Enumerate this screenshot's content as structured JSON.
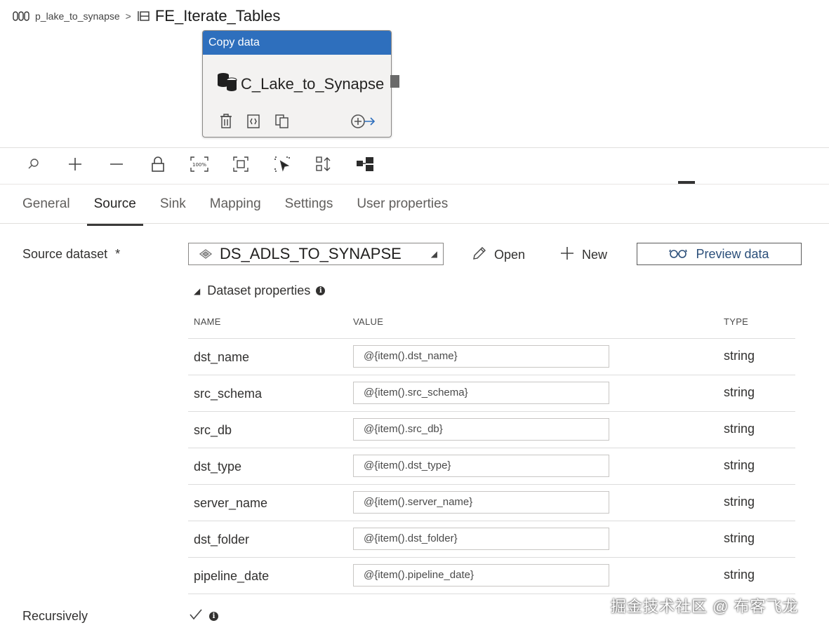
{
  "breadcrumb": {
    "pipeline": "p_lake_to_synapse",
    "separator": ">",
    "activity": "FE_Iterate_Tables"
  },
  "card": {
    "header": "Copy data",
    "name": "C_Lake_to_Synapse",
    "header_color": "#2e6fbd"
  },
  "toolbar": {
    "icons": [
      "search-icon",
      "zoom-in-icon",
      "zoom-out-icon",
      "lock-icon",
      "zoom-100-icon",
      "fit-to-screen-icon",
      "select-icon",
      "auto-align-icon",
      "layout-icon"
    ],
    "zoom_label": "100%"
  },
  "tabs": [
    "General",
    "Source",
    "Sink",
    "Mapping",
    "Settings",
    "User properties"
  ],
  "active_tab": "Source",
  "source": {
    "label": "Source dataset",
    "required": "*",
    "dataset": "DS_ADLS_TO_SYNAPSE",
    "open_label": "Open",
    "new_label": "New",
    "preview_label": "Preview data"
  },
  "dataset_properties": {
    "title": "Dataset properties",
    "columns": {
      "name": "NAME",
      "value": "VALUE",
      "type": "TYPE"
    },
    "rows": [
      {
        "name": "dst_name",
        "value": "@{item().dst_name}",
        "type": "string"
      },
      {
        "name": "src_schema",
        "value": "@{item().src_schema}",
        "type": "string"
      },
      {
        "name": "src_db",
        "value": "@{item().src_db}",
        "type": "string"
      },
      {
        "name": "dst_type",
        "value": "@{item().dst_type}",
        "type": "string"
      },
      {
        "name": "server_name",
        "value": "@{item().server_name}",
        "type": "string"
      },
      {
        "name": "dst_folder",
        "value": "@{item().dst_folder}",
        "type": "string"
      },
      {
        "name": "pipeline_date",
        "value": "@{item().pipeline_date}",
        "type": "string"
      }
    ]
  },
  "recursively": {
    "label": "Recursively",
    "checked": true
  },
  "watermark": "掘金技术社区 @ 布客飞龙"
}
